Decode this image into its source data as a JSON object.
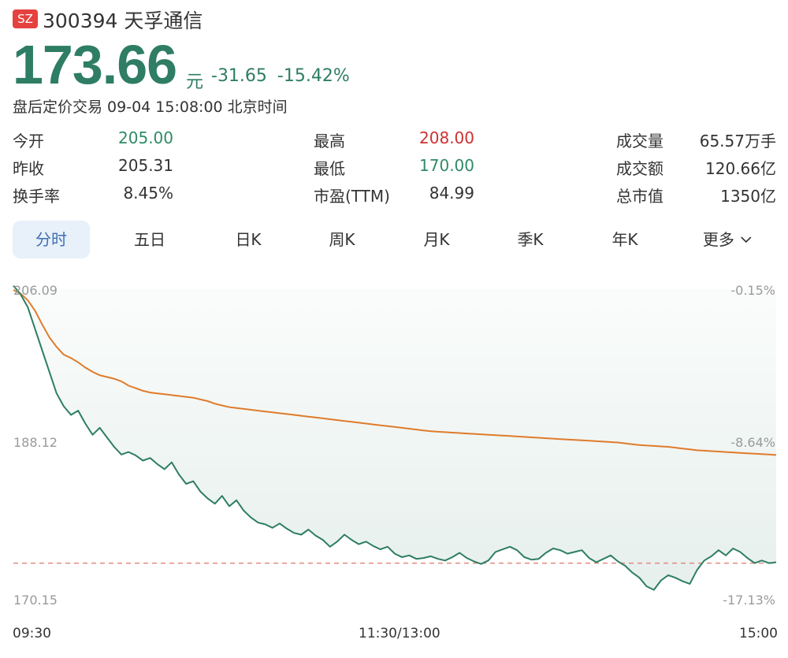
{
  "header": {
    "exchange_badge": "SZ",
    "code_name": "300394 天孚通信",
    "price": "173.66",
    "price_unit": "元",
    "change": "-31.65",
    "change_pct": "-15.42%",
    "status_line": "盘后定价交易 09-04 15:08:00 北京时间"
  },
  "stats": [
    {
      "label": "今开",
      "value": "205.00",
      "tone": "green"
    },
    {
      "label": "最高",
      "value": "208.00",
      "tone": "red"
    },
    {
      "label": "成交量",
      "value": "65.57万手",
      "tone": "plain"
    },
    {
      "label": "昨收",
      "value": "205.31",
      "tone": "plain"
    },
    {
      "label": "最低",
      "value": "170.00",
      "tone": "green"
    },
    {
      "label": "成交额",
      "value": "120.66亿",
      "tone": "plain"
    },
    {
      "label": "换手率",
      "value": "8.45%",
      "tone": "plain"
    },
    {
      "label": "市盈(TTM)",
      "value": "84.99",
      "tone": "plain"
    },
    {
      "label": "总市值",
      "value": "1350亿",
      "tone": "plain"
    }
  ],
  "tabs": [
    "分时",
    "五日",
    "日K",
    "周K",
    "月K",
    "季K",
    "年K",
    "更多"
  ],
  "active_tab": 0,
  "colors": {
    "price_green": "#2e7d64",
    "avg_orange": "#e07b2b",
    "prev_close_dash": "#e08a80",
    "tab_active": "#3e6fb4"
  },
  "chart_data": {
    "type": "line",
    "y_left_ticks": [
      "206.09",
      "188.12",
      "170.15"
    ],
    "y_right_ticks": [
      "-0.15%",
      "-8.64%",
      "-17.13%"
    ],
    "x_ticks": [
      "09:30",
      "11:30/13:00",
      "15:00"
    ],
    "ylim": [
      170.15,
      206.09
    ],
    "prev_close": 174.3,
    "price_series": [
      206.5,
      205.5,
      204.0,
      201.5,
      199.0,
      196.5,
      194.0,
      192.5,
      191.5,
      192.0,
      190.5,
      189.2,
      190.0,
      188.9,
      187.8,
      186.9,
      187.2,
      186.8,
      186.2,
      186.5,
      185.8,
      185.2,
      186.0,
      184.6,
      183.5,
      183.8,
      182.6,
      181.8,
      181.2,
      182.1,
      180.9,
      181.6,
      180.4,
      179.6,
      179.0,
      178.8,
      178.4,
      178.9,
      178.3,
      177.8,
      177.6,
      178.2,
      177.5,
      177.0,
      176.2,
      176.8,
      177.6,
      177.0,
      176.5,
      176.8,
      176.3,
      175.9,
      176.2,
      175.4,
      175.0,
      175.2,
      174.8,
      174.9,
      175.1,
      174.8,
      174.6,
      175.0,
      175.5,
      174.9,
      174.5,
      174.2,
      174.6,
      175.6,
      175.9,
      176.2,
      175.8,
      175.0,
      174.7,
      174.8,
      175.5,
      176.0,
      175.8,
      175.4,
      175.6,
      175.8,
      174.9,
      174.4,
      174.8,
      175.2,
      174.5,
      174.0,
      173.2,
      172.6,
      171.6,
      171.2,
      172.3,
      172.9,
      172.6,
      172.2,
      171.9,
      173.5,
      174.6,
      175.1,
      175.8,
      175.2,
      176.0,
      175.6,
      174.9,
      174.3,
      174.6,
      174.3,
      174.4
    ],
    "avg_series": [
      206.0,
      205.6,
      204.8,
      203.6,
      202.0,
      200.5,
      199.4,
      198.5,
      198.1,
      197.6,
      197.0,
      196.5,
      196.1,
      195.9,
      195.7,
      195.4,
      194.9,
      194.6,
      194.3,
      194.1,
      194.0,
      193.9,
      193.8,
      193.7,
      193.6,
      193.5,
      193.3,
      193.1,
      192.8,
      192.6,
      192.4,
      192.3,
      192.2,
      192.1,
      192.0,
      191.9,
      191.8,
      191.7,
      191.6,
      191.5,
      191.4,
      191.3,
      191.2,
      191.1,
      191.0,
      190.9,
      190.8,
      190.7,
      190.6,
      190.5,
      190.4,
      190.3,
      190.2,
      190.1,
      190.0,
      189.9,
      189.8,
      189.7,
      189.6,
      189.55,
      189.5,
      189.45,
      189.4,
      189.35,
      189.3,
      189.25,
      189.2,
      189.15,
      189.1,
      189.05,
      189.0,
      188.95,
      188.9,
      188.85,
      188.8,
      188.75,
      188.7,
      188.65,
      188.6,
      188.55,
      188.5,
      188.45,
      188.4,
      188.35,
      188.3,
      188.2,
      188.1,
      188.0,
      187.95,
      187.9,
      187.85,
      187.8,
      187.7,
      187.6,
      187.5,
      187.4,
      187.35,
      187.3,
      187.25,
      187.2,
      187.15,
      187.1,
      187.05,
      187.0,
      186.95,
      186.9,
      186.85
    ]
  }
}
